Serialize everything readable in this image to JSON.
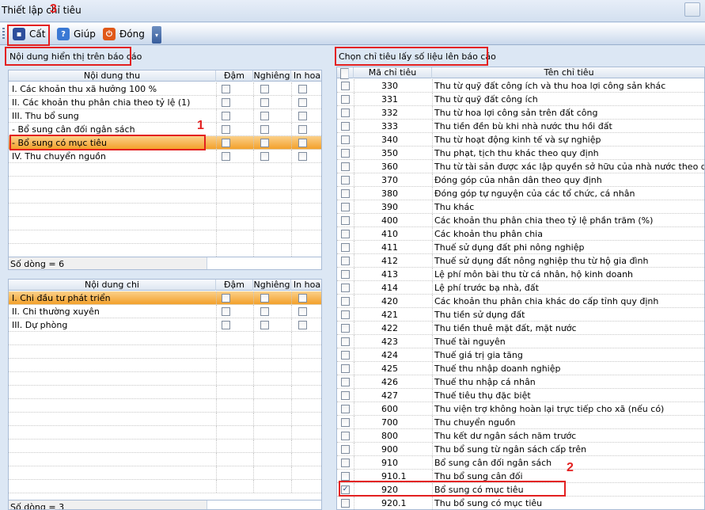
{
  "window": {
    "title": "Thiết lập chỉ tiêu"
  },
  "toolbar": {
    "save_label": "Cất",
    "help_label": "Giúp",
    "close_label": "Đóng"
  },
  "callouts": {
    "one": "1",
    "two": "2",
    "three": "3"
  },
  "left_top": {
    "section_label": "Nội dung hiển thị trên báo cáo",
    "headers": [
      "Nội dung thu",
      "Đậm",
      "Nghiêng",
      "In hoa"
    ],
    "rows": [
      {
        "name": "I. Các khoản thu xã hưởng 100 %",
        "selected": false
      },
      {
        "name": "II. Các khoản thu phân chia theo tỷ lệ (1)",
        "selected": false
      },
      {
        "name": "III. Thu bổ sung",
        "selected": false
      },
      {
        "name": "- Bổ sung cân đối ngân sách",
        "selected": false
      },
      {
        "name": "- Bổ sung có mục tiêu",
        "selected": true
      },
      {
        "name": "IV. Thu chuyển nguồn",
        "selected": false
      }
    ],
    "footer": "Số dòng = 6"
  },
  "left_bottom": {
    "headers": [
      "Nội dung chi",
      "Đậm",
      "Nghiêng",
      "In hoa"
    ],
    "rows": [
      {
        "name": "I. Chi đầu tư phát triển",
        "selected": true
      },
      {
        "name": "II. Chi thường xuyên",
        "selected": false
      },
      {
        "name": "III. Dự phòng",
        "selected": false
      }
    ],
    "footer": "Số dòng = 3"
  },
  "right": {
    "section_label": "Chọn chỉ tiêu lấy số liệu lên báo cáo",
    "headers": [
      "Mã chỉ tiêu",
      "Tên chỉ tiêu"
    ],
    "rows": [
      {
        "code": "330",
        "name": "Thu từ quỹ đất công ích và thu hoa lợi công sản khác",
        "checked": false
      },
      {
        "code": "331",
        "name": "Thu từ quỹ đất công ích",
        "checked": false
      },
      {
        "code": "332",
        "name": "Thu từ hoa lợi công sản trên đất công",
        "checked": false
      },
      {
        "code": "333",
        "name": "Thu tiền đền bù khi nhà nước thu hồi đất",
        "checked": false
      },
      {
        "code": "340",
        "name": "Thu từ hoạt động kinh tế và sự nghiệp",
        "checked": false
      },
      {
        "code": "350",
        "name": "Thu phạt, tịch thu khác theo quy định",
        "checked": false
      },
      {
        "code": "360",
        "name": "Thu từ tài sản được xác lập quyền sở hữu của nhà nước theo quy định",
        "checked": false
      },
      {
        "code": "370",
        "name": "Đóng góp của nhân dân theo quy định",
        "checked": false
      },
      {
        "code": "380",
        "name": "Đóng góp tự nguyện của các tổ chức, cá nhân",
        "checked": false
      },
      {
        "code": "390",
        "name": "Thu khác",
        "checked": false
      },
      {
        "code": "400",
        "name": "Các khoản thu phân chia theo tỷ lệ phần trăm (%)",
        "checked": false
      },
      {
        "code": "410",
        "name": "Các khoản thu phân chia",
        "checked": false
      },
      {
        "code": "411",
        "name": "Thuế sử dụng đất phi nông nghiệp",
        "checked": false
      },
      {
        "code": "412",
        "name": "Thuế sử dụng đất nông nghiệp thu từ hộ gia đình",
        "checked": false
      },
      {
        "code": "413",
        "name": "Lệ phí môn bài thu từ cá nhân, hộ kinh doanh",
        "checked": false
      },
      {
        "code": "414",
        "name": "Lệ phí trước bạ nhà, đất",
        "checked": false
      },
      {
        "code": "420",
        "name": "Các khoản thu phân chia khác do cấp tỉnh quy định",
        "checked": false
      },
      {
        "code": "421",
        "name": "Thu tiền sử dụng đất",
        "checked": false
      },
      {
        "code": "422",
        "name": "Thu tiền thuê mặt đất, mặt nước",
        "checked": false
      },
      {
        "code": "423",
        "name": "Thuế tài nguyên",
        "checked": false
      },
      {
        "code": "424",
        "name": "Thuế giá trị gia tăng",
        "checked": false
      },
      {
        "code": "425",
        "name": "Thuế thu nhập doanh nghiệp",
        "checked": false
      },
      {
        "code": "426",
        "name": "Thuế thu nhập cá nhân",
        "checked": false
      },
      {
        "code": "427",
        "name": "Thuế tiêu thụ đặc biệt",
        "checked": false
      },
      {
        "code": "600",
        "name": "Thu viện trợ không hoàn lại trực tiếp cho xã (nếu có)",
        "checked": false
      },
      {
        "code": "700",
        "name": "Thu chuyển nguồn",
        "checked": false
      },
      {
        "code": "800",
        "name": "Thu kết dư ngân sách năm trước",
        "checked": false
      },
      {
        "code": "900",
        "name": "Thu bổ sung từ ngân sách cấp trên",
        "checked": false
      },
      {
        "code": "910",
        "name": "Bổ sung cân đối ngân sách",
        "checked": false
      },
      {
        "code": "910.1",
        "name": "Thu bổ sung cân đối",
        "checked": false
      },
      {
        "code": "920",
        "name": "Bổ sung có mục tiêu",
        "checked": true
      },
      {
        "code": "920.1",
        "name": "Thu bổ sung có mục tiêu",
        "checked": false
      }
    ]
  },
  "colors": {
    "selected_row": "#f3a12b",
    "callout_red": "#e32020"
  },
  "icons": {
    "save": "floppy-disk-icon",
    "help": "help-icon",
    "close": "power-icon"
  }
}
